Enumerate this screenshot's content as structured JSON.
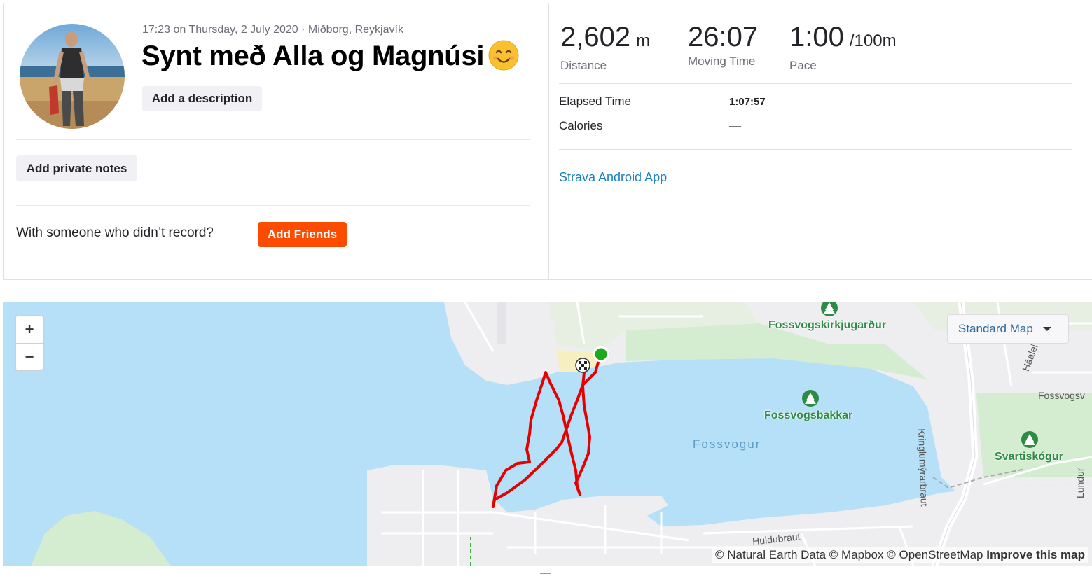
{
  "activity": {
    "meta": "17:23 on Thursday, 2 July 2020 · Miðborg, Reykjavík",
    "title": "Synt með Alla og Magnúsi",
    "add_description_label": "Add a description",
    "add_private_notes_label": "Add private notes",
    "with_someone_text": "With someone who didn’t record?",
    "add_friends_label": "Add Friends"
  },
  "stats": {
    "distance": {
      "value": "2,602",
      "unit": "m",
      "label": "Distance"
    },
    "moving_time": {
      "value": "26:07",
      "label": "Moving Time"
    },
    "pace": {
      "value": "1:00",
      "unit": "/100m",
      "label": "Pace"
    }
  },
  "more_stats": [
    {
      "label": "Elapsed Time",
      "value": "1:07:57"
    },
    {
      "label": "Calories",
      "value": "—"
    }
  ],
  "device": "Strava Android App",
  "map": {
    "zoom_in": "+",
    "zoom_out": "−",
    "style_selector": "Standard Map",
    "attribution": "© Natural Earth Data © Mapbox © OpenStreetMap",
    "improve_link": "Improve this map",
    "labels": {
      "cemetery": "Fossvogskirkjugarður",
      "bakkar": "Fossvogsbakkar",
      "bay": "Fossvogur",
      "forest": "Svartiskógur",
      "road_kringlu": "Kringlumýrarbraut",
      "road_huldu": "Huldubraut",
      "road_haaleiti": "Háalei",
      "road_fossvogs": "Fossvogsv",
      "road_lundur": "Lundur"
    },
    "route_color": "#e60000",
    "start_color": "#1aaa1a"
  },
  "colors": {
    "accent": "#fc4c02",
    "link": "#1b7fc2",
    "water": "#b5e0f7",
    "park": "#d4ecd0",
    "land": "#eeeef0"
  }
}
